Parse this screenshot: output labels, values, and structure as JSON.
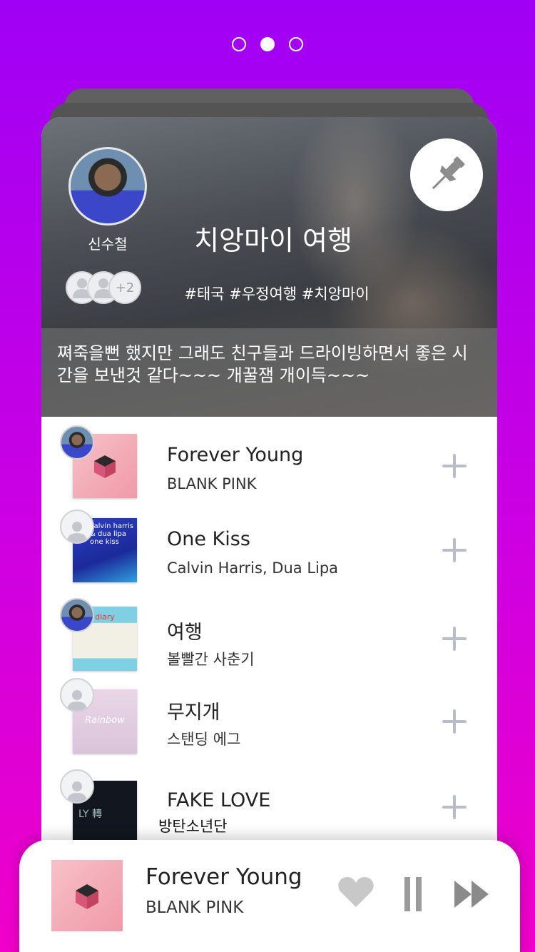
{
  "pager": {
    "count": 3,
    "active_index": 1
  },
  "playlist": {
    "owner_name": "신수철",
    "title": "치앙마이 여행",
    "extra_members": "+2",
    "tags": "#태국 #우정여행 #치앙마이",
    "description": "쪄죽을뻔 했지만 그래도 친구들과 드라이빙하면서 좋은 시간을 보낸것 같다~~~ 개꿀잼 개이득~~~"
  },
  "songs": [
    {
      "title": "Forever Young",
      "artist": "BLANK PINK",
      "cover_color": "#f3a9b3",
      "added_by": "user"
    },
    {
      "title": "One Kiss",
      "artist": "Calvin Harris, Dua Lipa",
      "cover_color": "#1f3fbf",
      "cover_text": "calvin harris & dua lipa one kiss",
      "added_by": "default"
    },
    {
      "title": "여행",
      "artist": "볼빨간 사춘기",
      "cover_color": "#7fd0e3",
      "cover_text": "diary",
      "added_by": "user"
    },
    {
      "title": "무지개",
      "artist": "스탠딩 에그",
      "cover_color": "#e7cfe0",
      "cover_text": "Rainbow",
      "added_by": "default"
    },
    {
      "title": "FAKE LOVE",
      "artist": "방탄소년단",
      "cover_color": "#12161e",
      "cover_text": "LY 轉",
      "added_by": "default"
    }
  ],
  "now_playing": {
    "title": "Forever Young",
    "artist": "BLANK PINK",
    "cover_color": "#f3a9b3"
  },
  "colors": {
    "plus_icon": "#b7bec9",
    "control_icon": "#9a9a9a",
    "background_top": "#a000f5",
    "background_bottom": "#f000c8"
  }
}
